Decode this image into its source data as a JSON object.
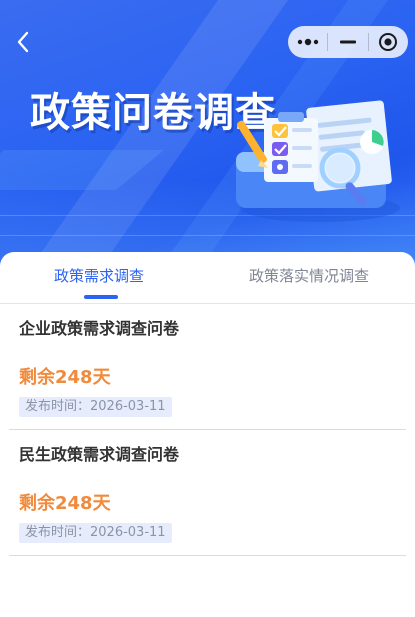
{
  "nav": {
    "back_icon": "chevron-left-icon",
    "capsule": {
      "more_icon": "more-dots-icon",
      "minimize_icon": "minimize-icon",
      "close_icon": "target-close-icon"
    }
  },
  "banner": {
    "title": "政策问卷调查",
    "illustration_icon": "survey-clipboard-magnifier-illustration"
  },
  "tabs": [
    {
      "label": "政策需求调查",
      "active": true
    },
    {
      "label": "政策落实情况调查",
      "active": false
    }
  ],
  "surveys": [
    {
      "title": "企业政策需求调查问卷",
      "remaining": "剩余248天",
      "publish": "发布时间：2026-03-11"
    },
    {
      "title": "民生政策需求调查问卷",
      "remaining": "剩余248天",
      "publish": "发布时间：2026-03-11"
    }
  ],
  "colors": {
    "brand_blue": "#2b63f2",
    "remaining_orange": "#f08a3c",
    "inactive_tab": "#7f8594"
  }
}
